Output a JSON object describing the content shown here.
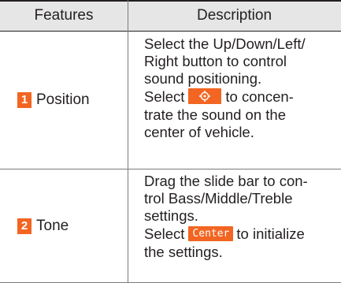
{
  "table": {
    "headers": {
      "features": "Features",
      "description": "Description"
    },
    "rows": [
      {
        "number": "1",
        "feature": "Position",
        "description": {
          "line1": "Select the Up/Down/Left/",
          "line2": "Right button to control",
          "line3": "sound positioning.",
          "line4_before": "Select",
          "line4_after": "to concen-",
          "line5": "trate the sound on the",
          "line6": "center of vehicle."
        },
        "inline_icon": "position-center-icon"
      },
      {
        "number": "2",
        "feature": "Tone",
        "description": {
          "line1": "Drag the slide bar to con-",
          "line2": "trol Bass/Middle/Treble",
          "line3": "settings.",
          "line4_before": "Select",
          "line4_after": "to initialize",
          "line5": "the settings."
        },
        "inline_button": "Center"
      }
    ]
  },
  "colors": {
    "accent": "#f26522",
    "header_bg": "#e6e6e6",
    "text": "#231f20"
  }
}
